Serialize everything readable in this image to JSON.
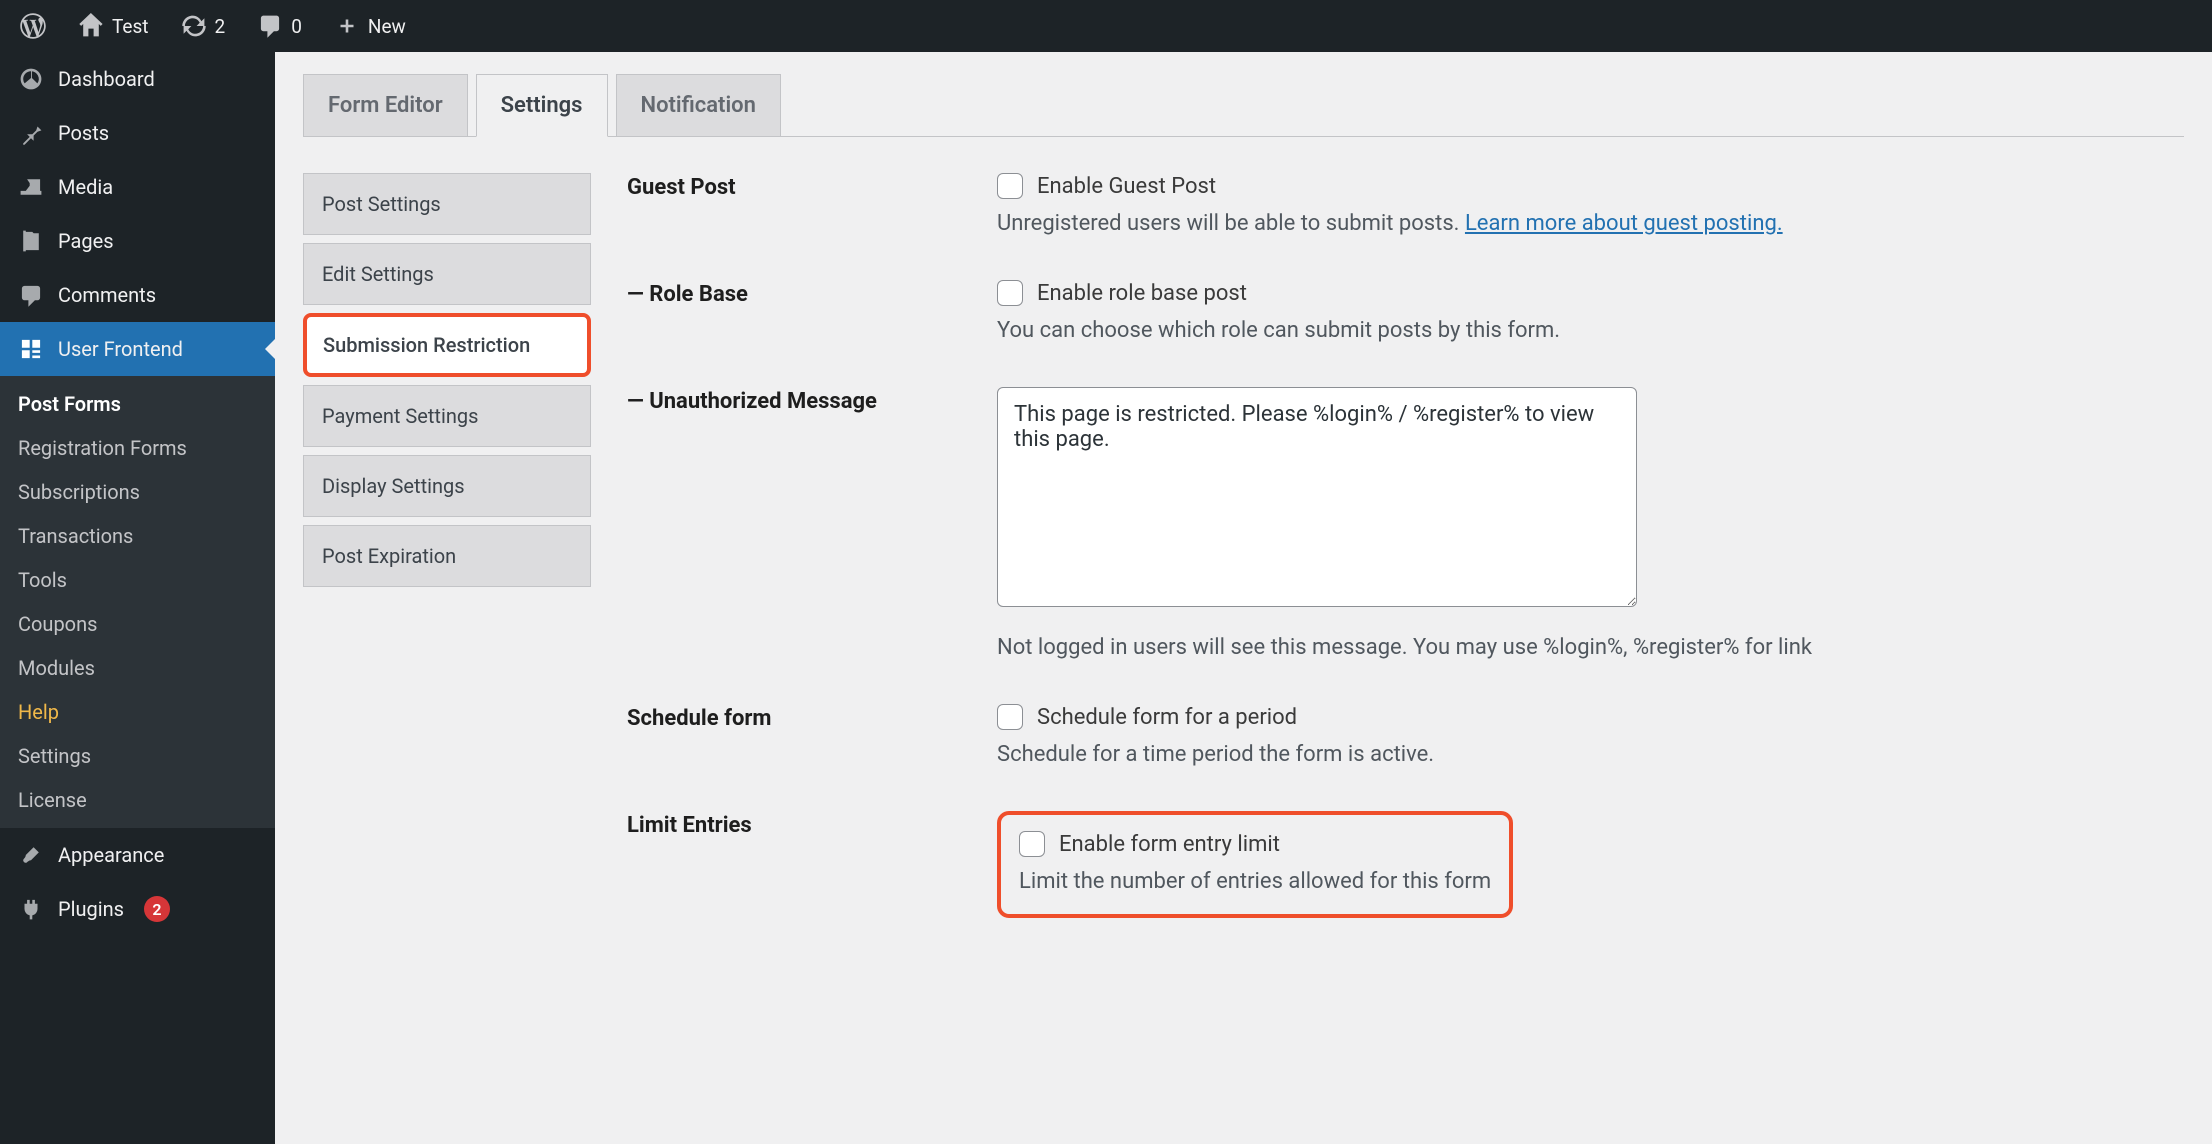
{
  "adminbar": {
    "site_name": "Test",
    "updates_count": "2",
    "comments_count": "0",
    "new_label": "New"
  },
  "sidebar": {
    "items": [
      {
        "label": "Dashboard",
        "icon": "dashboard"
      },
      {
        "label": "Posts",
        "icon": "pin"
      },
      {
        "label": "Media",
        "icon": "media"
      },
      {
        "label": "Pages",
        "icon": "page"
      },
      {
        "label": "Comments",
        "icon": "comment"
      },
      {
        "label": "User Frontend",
        "icon": "userfrontend",
        "active": true
      },
      {
        "label": "Appearance",
        "icon": "brush"
      },
      {
        "label": "Plugins",
        "icon": "plug",
        "badge": "2"
      }
    ],
    "submenu": [
      {
        "label": "Post Forms",
        "current": true
      },
      {
        "label": "Registration Forms"
      },
      {
        "label": "Subscriptions"
      },
      {
        "label": "Transactions"
      },
      {
        "label": "Tools"
      },
      {
        "label": "Coupons"
      },
      {
        "label": "Modules"
      },
      {
        "label": "Help",
        "help": true
      },
      {
        "label": "Settings"
      },
      {
        "label": "License"
      }
    ]
  },
  "tabs": [
    {
      "label": "Form Editor"
    },
    {
      "label": "Settings",
      "active": true
    },
    {
      "label": "Notification"
    }
  ],
  "settings_nav": [
    {
      "label": "Post Settings"
    },
    {
      "label": "Edit Settings"
    },
    {
      "label": "Submission Restriction",
      "active": true
    },
    {
      "label": "Payment Settings"
    },
    {
      "label": "Display Settings"
    },
    {
      "label": "Post Expiration"
    }
  ],
  "fields": {
    "guest_post": {
      "label": "Guest Post",
      "checkbox_label": "Enable Guest Post",
      "helper_pre": "Unregistered users will be able to submit posts. ",
      "helper_link": "Learn more about guest posting."
    },
    "role_base": {
      "label": "— Role Base",
      "checkbox_label": "Enable role base post",
      "helper": "You can choose which role can submit posts by this form."
    },
    "unauth": {
      "label": "— Unauthorized Message",
      "value": "This page is restricted. Please %login% / %register% to view this page.",
      "helper": "Not logged in users will see this message. You may use %login%, %register% for link"
    },
    "schedule": {
      "label": "Schedule form",
      "checkbox_label": "Schedule form for a period",
      "helper": "Schedule for a time period the form is active."
    },
    "limit": {
      "label": "Limit Entries",
      "checkbox_label": "Enable form entry limit",
      "helper": "Limit the number of entries allowed for this form"
    }
  }
}
